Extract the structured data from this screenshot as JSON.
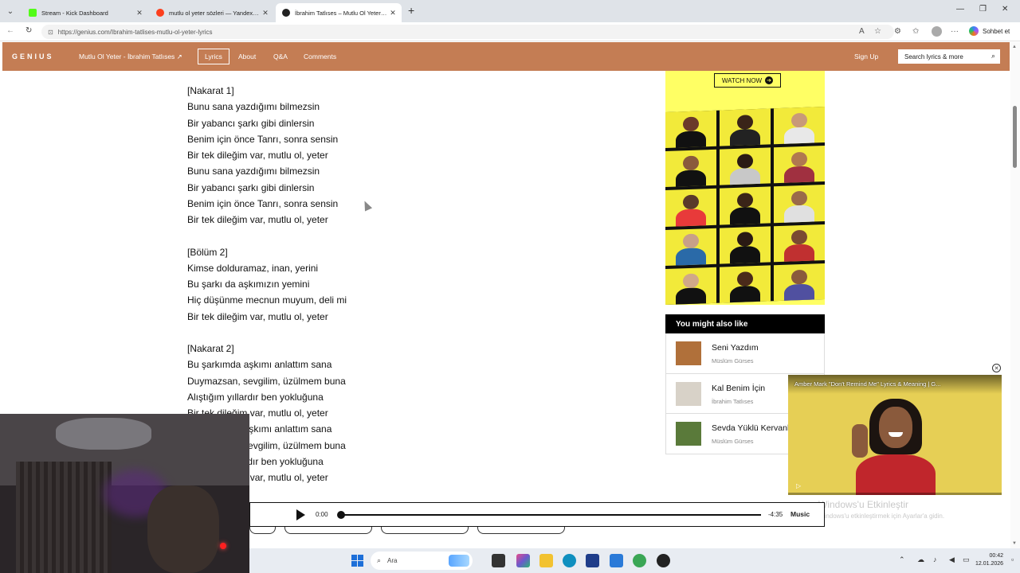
{
  "browser": {
    "tabs": [
      {
        "title": "Stream - Kick Dashboard",
        "favicon_color": "#53fc18"
      },
      {
        "title": "mutlu ol yeter sözleri — Yandex: 4...",
        "favicon_color": "#fc3f1d"
      },
      {
        "title": "İbrahim Tatlıses – Mutlu Ol Yeter Ly...",
        "favicon_color": "#222222"
      }
    ],
    "url": "https://genius.com/Ibrahim-tatlises-mutlu-ol-yeter-lyrics",
    "copilot_label": "Sohbet et"
  },
  "genius": {
    "logo": "GENIUS",
    "song_link": "Mutlu Ol Yeter - İbrahim Tatlıses ↗",
    "nav": [
      "Lyrics",
      "About",
      "Q&A",
      "Comments"
    ],
    "signup": "Sign Up",
    "search_placeholder": "Search lyrics & more",
    "brand_color": "#c47d54"
  },
  "lyrics": [
    "[Nakarat 1]",
    "Bunu sana yazdığımı bilmezsin",
    "Bir yabancı şarkı gibi dinlersin",
    "Benim için önce Tanrı, sonra sensin",
    "Bir tek dileğim var, mutlu ol, yeter",
    "Bunu sana yazdığımı bilmezsin",
    "Bir yabancı şarkı gibi dinlersin",
    "Benim için önce Tanrı, sonra sensin",
    "Bir tek dileğim var, mutlu ol, yeter",
    "",
    "[Bölüm 2]",
    "Kimse dolduramaz, inan, yerini",
    "Bu şarkı da aşkımızın yemini",
    "Hiç düşünme mecnun muyum, deli mi",
    "Bir tek dileğim var, mutlu ol, yeter",
    "",
    "[Nakarat 2]",
    "Bu şarkımda aşkımı anlattım sana",
    "Duymazsan, sevgilim, üzülmem buna",
    "Alıştığım yıllardır ben yokluğuna",
    "Bir tek dileğim var, mutlu ol, yeter",
    "Bu şarkımda aşkımı anlattım sana",
    "Duymazsan, sevgilim, üzülmem buna",
    "Alıştığım yıllardır ben yokluğuna",
    "Bir tek dileğim var, mutlu ol, yeter"
  ],
  "ad": {
    "cta": "WATCH NOW",
    "bg_color": "#ffff64"
  },
  "also_like": {
    "header": "You might also like",
    "songs": [
      {
        "title": "Seni Yazdım",
        "artist": "Müslüm Gürses",
        "thumb_color": "#b0703a"
      },
      {
        "title": "Kal Benim İçin",
        "artist": "İbrahim Tatlıses",
        "thumb_color": "#d8d2c8"
      },
      {
        "title": "Sevda Yüklü Kervanlar",
        "artist": "Müslüm Gürses",
        "thumb_color": "#5a7a3a"
      }
    ]
  },
  "video": {
    "title": "Amber Mark \"Don't Remind Me\" Lyrics & Meaning | G..."
  },
  "windows_activation": {
    "title": "Windows'u Etkinleştir",
    "subtitle": "Windows'u etkinleştirmek için Ayarlar'a gidin."
  },
  "player": {
    "elapsed": "0:00",
    "remaining": "-4:35",
    "service": "Music"
  },
  "taskbar": {
    "search_placeholder": "Ara",
    "time": "00:42",
    "date": "12.01.2026"
  }
}
